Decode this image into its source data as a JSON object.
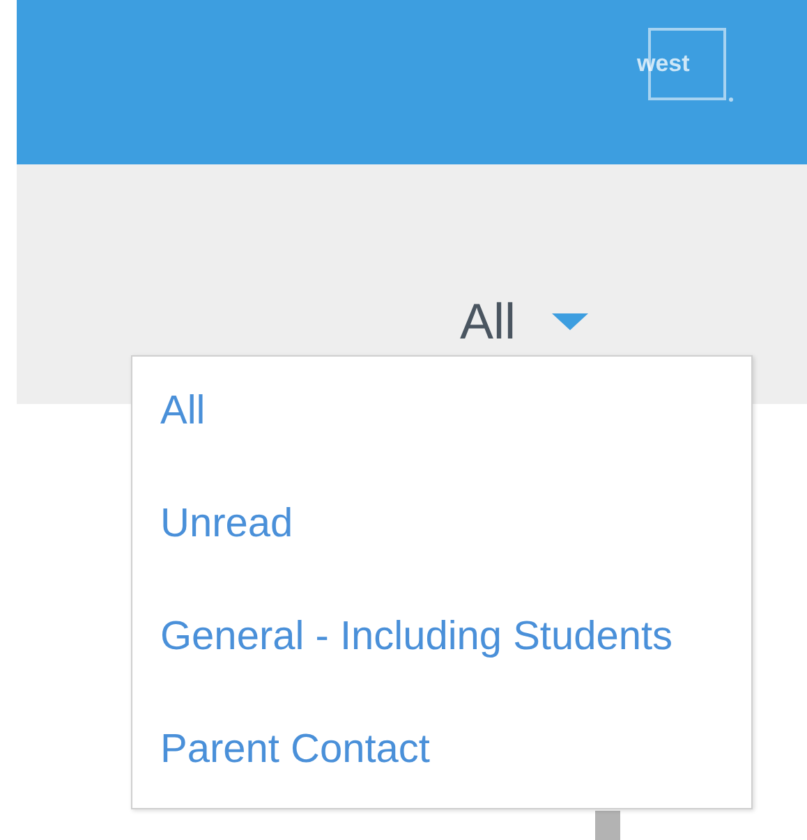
{
  "header": {
    "logo": "west"
  },
  "filter": {
    "value": "All",
    "expanded": true
  },
  "menu_items": [
    {
      "label": "All"
    },
    {
      "label": "Unread"
    },
    {
      "label": "General - Including Students"
    },
    {
      "label": "Parent Contact"
    }
  ]
}
